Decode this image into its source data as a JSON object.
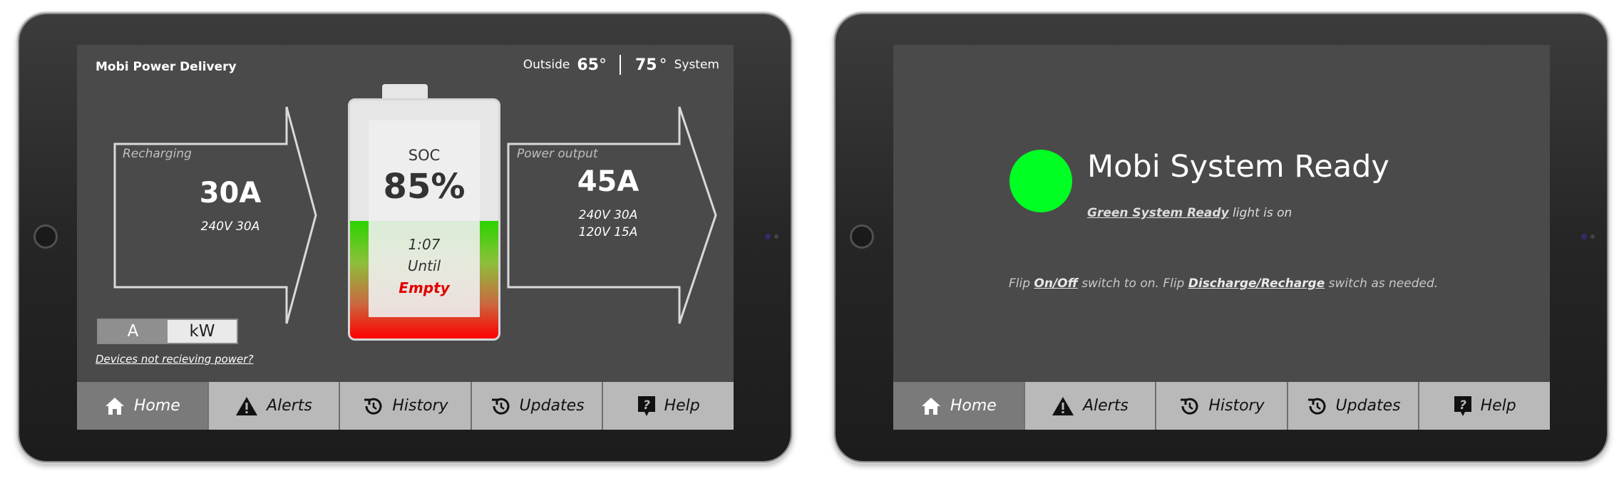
{
  "left_screen": {
    "app_title": "Mobi Power Delivery",
    "outside_label": "Outside",
    "outside_temp": "65",
    "system_temp": "75",
    "system_label": "System",
    "degree": "°",
    "recharging": {
      "label": "Recharging",
      "value": "30A",
      "detail": "240V 30A"
    },
    "battery": {
      "soc_label": "SOC",
      "soc_value": "85%",
      "time": "1:07",
      "until": "Until",
      "state": "Empty",
      "level": 0.85
    },
    "power_output": {
      "label": "Power output",
      "value": "45A",
      "detail_1": "240V 30A",
      "detail_2": "120V 15A"
    },
    "units": {
      "a": "A",
      "kw": "kW",
      "selected": "A"
    },
    "devices_link": "Devices not recieving power?"
  },
  "right_screen": {
    "title": "Mobi System Ready",
    "sub_link": "Green System Ready",
    "sub_rest": " light is on",
    "instr_1": "Flip ",
    "instr_link_1": "On/Off",
    "instr_2": " switch to on. Flip ",
    "instr_link_2": "Discharge/Recharge",
    "instr_3": " switch as needed."
  },
  "nav": {
    "home": "Home",
    "alerts": "Alerts",
    "history": "History",
    "updates": "Updates",
    "help": "Help"
  },
  "colors": {
    "ready_green": "#00ff22",
    "empty_red": "#e00000",
    "screen_bg": "#4a4a4a"
  },
  "icons": [
    "home-icon",
    "alert-icon",
    "history-icon",
    "updates-icon",
    "help-icon"
  ]
}
